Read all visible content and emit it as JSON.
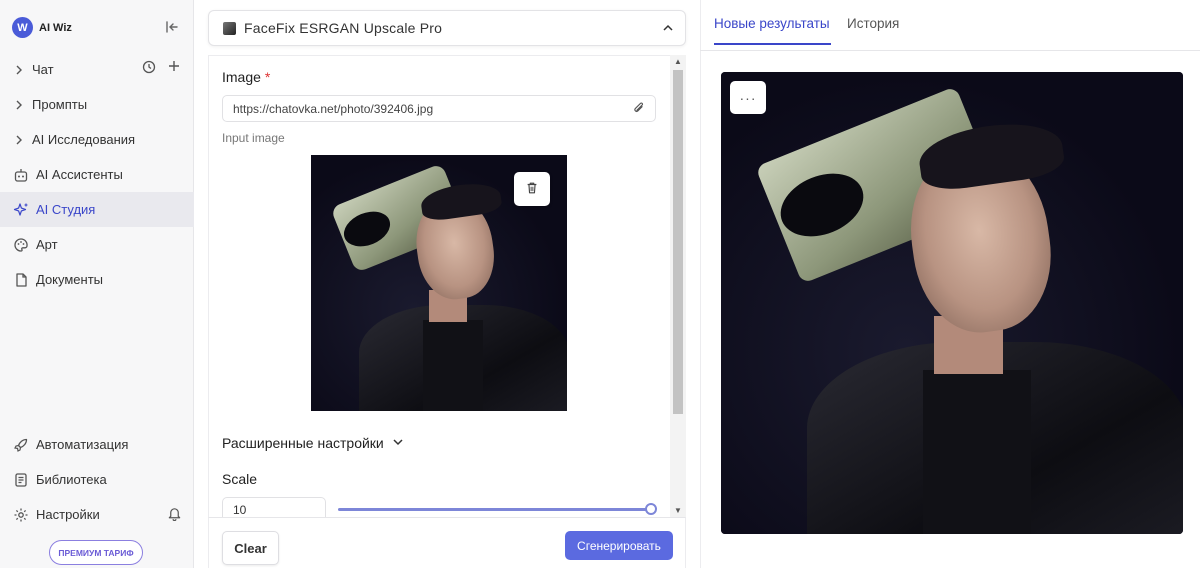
{
  "brand": {
    "name": "AI Wiz",
    "logo_letter": "W"
  },
  "sidebar": {
    "items": [
      {
        "label": "Чат",
        "icon": "chevron-right-icon"
      },
      {
        "label": "Промпты",
        "icon": "chevron-right-icon"
      },
      {
        "label": "AI Исследования",
        "icon": "chevron-right-icon"
      },
      {
        "label": "AI Ассистенты",
        "icon": "robot-icon"
      },
      {
        "label": "AI Студия",
        "icon": "sparkle-icon",
        "active": true
      },
      {
        "label": "Арт",
        "icon": "palette-icon"
      },
      {
        "label": "Документы",
        "icon": "document-icon"
      }
    ],
    "bottom_items": [
      {
        "label": "Автоматизация",
        "icon": "rocket-icon"
      },
      {
        "label": "Библиотека",
        "icon": "library-icon"
      },
      {
        "label": "Настройки",
        "icon": "gear-icon"
      }
    ],
    "premium_label": "ПРЕМИУМ ТАРИФ"
  },
  "model": {
    "name": "FaceFix ESRGAN Upscale Pro"
  },
  "form": {
    "image_label": "Image",
    "required_mark": "*",
    "image_url": "https://chatovka.net/photo/392406.jpg",
    "input_image_caption": "Input image",
    "advanced_settings_label": "Расширенные настройки",
    "scale_label": "Scale",
    "scale_value": "10",
    "scale_fraction": 1.0
  },
  "actions": {
    "clear_label": "Clear",
    "generate_label": "Сгенерировать"
  },
  "tabs": [
    {
      "label": "Новые результаты",
      "active": true
    },
    {
      "label": "История",
      "active": false
    }
  ],
  "result_menu_label": "···",
  "colors": {
    "accent": "#3a46c9",
    "button": "#5b6ae0",
    "premium": "#6a5bd6"
  }
}
